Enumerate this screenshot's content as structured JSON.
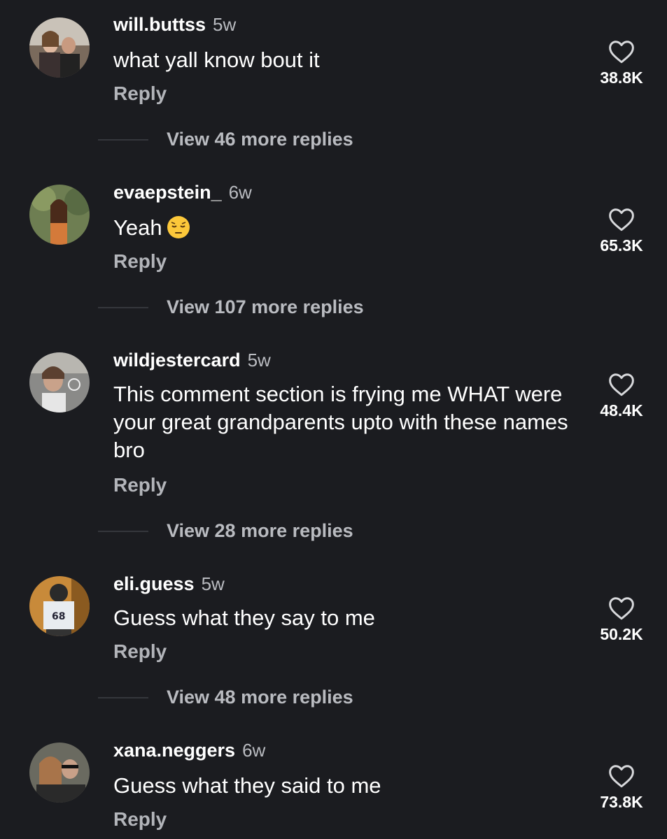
{
  "comments": [
    {
      "username": "will.buttss",
      "age": "5w",
      "text": "what yall know bout it",
      "reply_label": "Reply",
      "likes": "38.8K",
      "view_more": "View 46 more replies"
    },
    {
      "username": "evaepstein_",
      "age": "6w",
      "text": "Yeah",
      "emoji": "pensive-face-emoji",
      "reply_label": "Reply",
      "likes": "65.3K",
      "view_more": "View 107 more replies"
    },
    {
      "username": "wildjestercard",
      "age": "5w",
      "text": "This comment section is frying me WHAT were your great grandparents upto with these names bro",
      "reply_label": "Reply",
      "likes": "48.4K",
      "view_more": "View 28 more replies"
    },
    {
      "username": "eli.guess",
      "age": "5w",
      "text": "Guess what they say to me",
      "reply_label": "Reply",
      "likes": "50.2K",
      "view_more": "View 48 more replies"
    },
    {
      "username": "xana.neggers",
      "age": "6w",
      "text": "Guess what they said to me",
      "reply_label": "Reply",
      "likes": "73.8K"
    }
  ],
  "icons": {
    "like": "heart-outline-icon"
  },
  "colors": {
    "background": "#1b1c20",
    "secondary_text": "#b3b5ba"
  }
}
